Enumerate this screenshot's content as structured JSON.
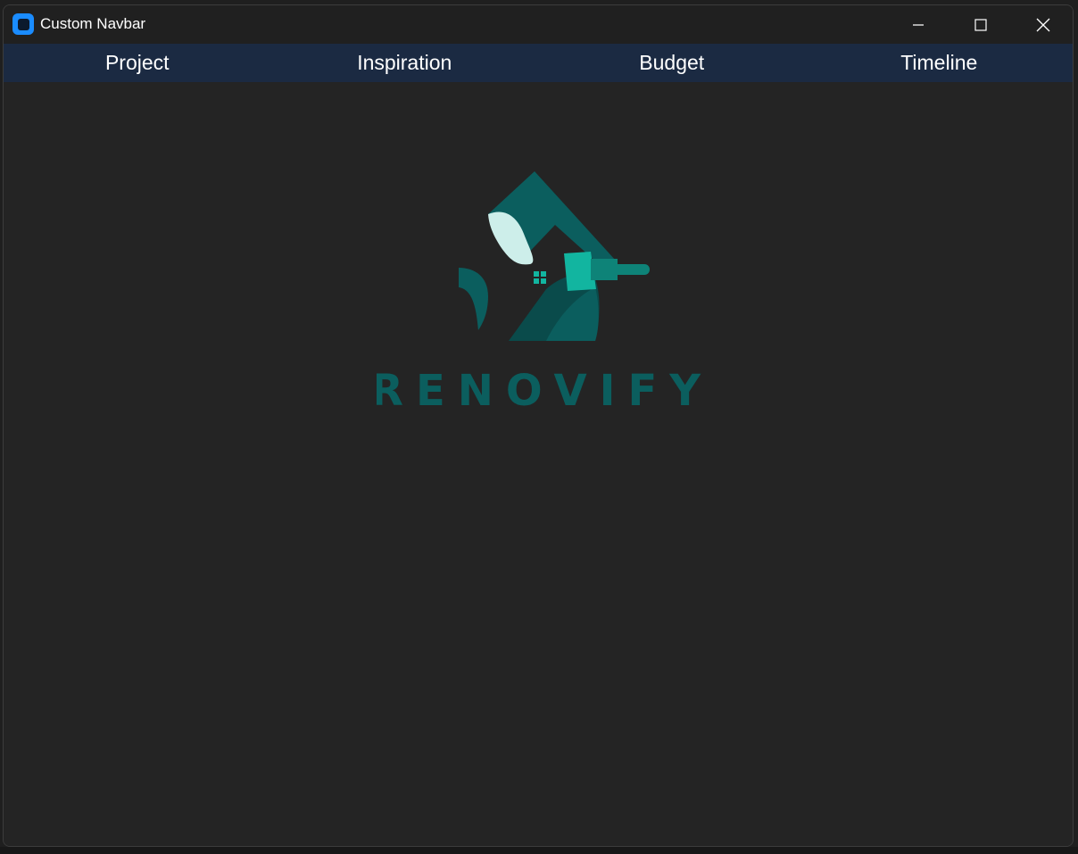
{
  "window": {
    "title": "Custom Navbar",
    "controls": [
      "minimize",
      "maximize",
      "close"
    ]
  },
  "navbar": {
    "items": [
      {
        "label": "Project"
      },
      {
        "label": "Inspiration"
      },
      {
        "label": "Budget"
      },
      {
        "label": "Timeline"
      }
    ],
    "background": "#1b2a42"
  },
  "logo": {
    "wordmark": "RENOVIFY",
    "colors": {
      "primary": "#0b5e5e",
      "dark": "#0a4b4b",
      "light": "#cdeeea",
      "accent": "#12b5a0"
    }
  },
  "colors": {
    "window_bg": "#242424",
    "titlebar_bg": "#202020",
    "app_icon": "#1a8cff"
  }
}
